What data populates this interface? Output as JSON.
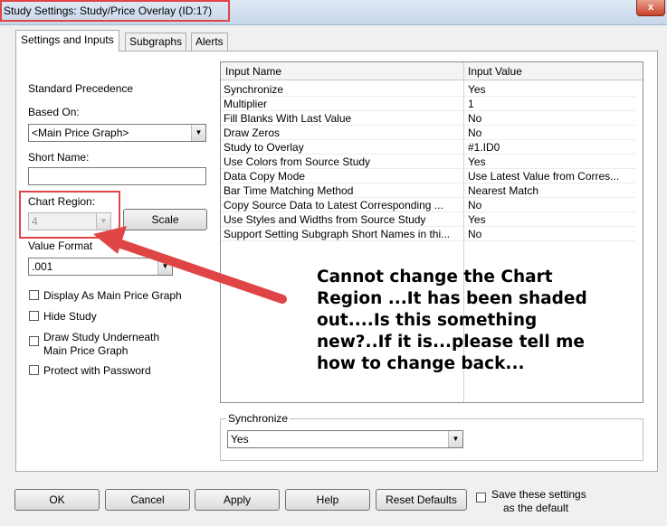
{
  "window": {
    "title": "Study Settings: Study/Price Overlay (ID:17)",
    "close_glyph": "x"
  },
  "tabs": [
    {
      "label": "Settings and Inputs"
    },
    {
      "label": "Subgraphs"
    },
    {
      "label": "Alerts"
    }
  ],
  "left": {
    "standard_precedence": "Standard Precedence",
    "based_on_label": "Based On:",
    "based_on_value": "<Main Price Graph>",
    "short_name_label": "Short Name:",
    "short_name_value": "",
    "chart_region_label": "Chart Region:",
    "chart_region_value": "4",
    "scale_button": "Scale",
    "value_format_label": "Value Format",
    "value_format_value": ".001",
    "checkboxes": [
      {
        "label": "Display As Main Price Graph",
        "checked": false
      },
      {
        "label": "Hide Study",
        "checked": false
      },
      {
        "label": "Draw Study Underneath",
        "label2": "Main Price Graph",
        "checked": false
      },
      {
        "label": "Protect with Password",
        "checked": false
      }
    ]
  },
  "grid": {
    "col_name": "Input Name",
    "col_value": "Input Value",
    "rows": [
      {
        "name": "Synchronize",
        "value": "Yes"
      },
      {
        "name": "Multiplier",
        "value": "1"
      },
      {
        "name": "Fill Blanks With Last Value",
        "value": "No"
      },
      {
        "name": "Draw Zeros",
        "value": "No"
      },
      {
        "name": "Study to Overlay",
        "value": "#1.ID0"
      },
      {
        "name": "Use Colors from Source Study",
        "value": "Yes"
      },
      {
        "name": "Data Copy Mode",
        "value": "Use Latest Value from Corres..."
      },
      {
        "name": "Bar Time Matching Method",
        "value": "Nearest Match"
      },
      {
        "name": "Copy Source Data to Latest Corresponding ...",
        "value": "No"
      },
      {
        "name": "Use Styles and Widths from Source Study",
        "value": "Yes"
      },
      {
        "name": "Support Setting Subgraph Short Names in thi...",
        "value": "No"
      }
    ]
  },
  "sync_group": {
    "title": "Synchronize",
    "value": "Yes"
  },
  "annotation": {
    "lines": [
      "Cannot change the Chart",
      "Region ...It has been shaded",
      "out....Is this something",
      "new?..If it is...please tell me",
      "how to change back..."
    ],
    "color": "#e04545"
  },
  "footer": {
    "ok": "OK",
    "cancel": "Cancel",
    "apply": "Apply",
    "help": "Help",
    "reset": "Reset Defaults",
    "save_default_line1": "Save these settings",
    "save_default_line2": "as the default",
    "save_default_checked": false
  }
}
